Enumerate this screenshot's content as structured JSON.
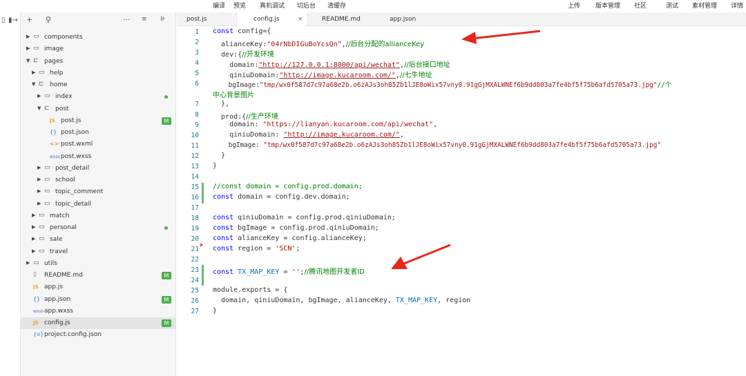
{
  "topbar": {
    "left_items": [
      "编译",
      "预览",
      "真机调试",
      "切后台",
      "清缓存"
    ],
    "right_items": [
      "上传",
      "版本管理",
      "社区",
      "测试",
      "素材管理",
      "详情"
    ]
  },
  "activity": {
    "icons": [
      "page-icon",
      "panel-right-icon"
    ]
  },
  "explorer": {
    "toolbar_icons": [
      "add-icon",
      "search-icon",
      "more-icon",
      "collapse-icon",
      "layout-icon"
    ],
    "tree": [
      {
        "label": "components",
        "kind": "folder",
        "expanded": false
      },
      {
        "label": "image",
        "kind": "folder",
        "expanded": false
      },
      {
        "label": "pages",
        "kind": "folder",
        "expanded": true
      },
      {
        "label": "help",
        "kind": "folder",
        "expanded": false
      },
      {
        "label": "home",
        "kind": "folder",
        "expanded": true
      },
      {
        "label": "index",
        "kind": "folder",
        "expanded": false
      },
      {
        "label": "post",
        "kind": "folder",
        "expanded": true
      },
      {
        "label": "post.js",
        "kind": "js",
        "badge": "M"
      },
      {
        "label": "post.json",
        "kind": "json"
      },
      {
        "label": "post.wxml",
        "kind": "wxml"
      },
      {
        "label": "post.wxss",
        "kind": "wxss"
      },
      {
        "label": "post_detail",
        "kind": "folder",
        "expanded": false
      },
      {
        "label": "school",
        "kind": "folder",
        "expanded": false
      },
      {
        "label": "topic_comment",
        "kind": "folder",
        "expanded": false
      },
      {
        "label": "topic_detail",
        "kind": "folder",
        "expanded": false
      },
      {
        "label": "match",
        "kind": "folder",
        "expanded": false
      },
      {
        "label": "personal",
        "kind": "folder",
        "expanded": false
      },
      {
        "label": "sale",
        "kind": "folder",
        "expanded": false
      },
      {
        "label": "travel",
        "kind": "folder",
        "expanded": false
      },
      {
        "label": "utils",
        "kind": "folder",
        "expanded": false
      },
      {
        "label": "README.md",
        "kind": "doc",
        "badge": "M"
      },
      {
        "label": "app.js",
        "kind": "js"
      },
      {
        "label": "app.json",
        "kind": "json",
        "badge": "M"
      },
      {
        "label": "app.wxss",
        "kind": "wxss"
      },
      {
        "label": "config.js",
        "kind": "js",
        "badge": "M",
        "selected": true
      },
      {
        "label": "project.config.json",
        "kind": "projjson"
      }
    ]
  },
  "tabs": [
    {
      "label": "post.js"
    },
    {
      "label": "config.js",
      "active": true,
      "close": "×"
    },
    {
      "label": "README.md"
    },
    {
      "label": "app.json"
    }
  ],
  "editor": {
    "line_numbers": [
      "1",
      "2",
      "3",
      "4",
      "5",
      "6",
      "7",
      "8",
      "9",
      "10",
      "11",
      "12",
      "13",
      "14",
      "15",
      "16",
      "17",
      "18",
      "19",
      "20",
      "21",
      "22",
      "23",
      "24",
      "25",
      "26",
      "27"
    ],
    "lines": {
      "l1": [
        "const",
        " config={"
      ],
      "l2": [
        "  alianceKey:",
        "\"04rNbDIGuBoYcsQn\"",
        ",",
        "//后台分配的allianceKey"
      ],
      "l3": [
        "  dev:{",
        "//开发环境"
      ],
      "l4": [
        "    domain:",
        "\"http://127.0.0.1:8000/api/wechat\"",
        ",",
        "//后台接口地址"
      ],
      "l5": [
        "    qiniuDomain:",
        "\"http://image.kucaroom.com/\"",
        ",",
        "//七牛地址"
      ],
      "l6": [
        "    bgImage:",
        "\"tmp/wx0f587d7c97a68e2b.o6zAJs3oh85Zb1lJE8oWix57vny0.91gGjMXALWNEf6b9dd803a7fe4bf5f75b6afd5705a73.jpg\"",
        "//个"
      ],
      "l6b": "中心背景图片",
      "l7": "  },",
      "l8": [
        "  prod:{",
        "//生产环境"
      ],
      "l9": [
        "    domain: ",
        "\"https://lianyan.kucaroom.com/api/wechat\"",
        ","
      ],
      "l10": [
        "    qiniuDomain: ",
        "\"http://image.kucaroom.com/\"",
        ","
      ],
      "l11": [
        "    bgImage: ",
        "\"tmp/wx0f587d7c97a68e2b.o6zAJs3oh85Zb1lJE8oWix57vny0.91gGjMXALWNEf6b9dd803a7fe4bf5f75b6afd5705a73.jpg\""
      ],
      "l12": "  }",
      "l13": "}",
      "l15": "//const domain = config.prod.domain;",
      "l16": [
        "const",
        " domain = config.dev.domain;"
      ],
      "l18": [
        "const",
        " qiniuDomain = config.prod.qiniuDomain;"
      ],
      "l19": [
        "const",
        " bgImage = config.prod.qiniuDomain;"
      ],
      "l20": [
        "const",
        " alianceKey = config.alianceKey;"
      ],
      "l21": [
        "const",
        " region = ",
        "'SCN'",
        ";"
      ],
      "l23": [
        "const",
        " ",
        "TX_MAP_KEY",
        " = ",
        "''",
        ";",
        "//腾讯地图开发者ID"
      ],
      "l25": "module.exports = {",
      "l26": [
        "  domain, qiniuDomain, bgImage, alianceKey, ",
        "TX_MAP_KEY",
        ", region"
      ],
      "l27": "}"
    }
  },
  "colors": {
    "keyword": "#0000ff",
    "string": "#a31515",
    "comment": "#008000",
    "line_number": "#237893",
    "badge": "#4caf50",
    "arrow": "#e8261c"
  }
}
